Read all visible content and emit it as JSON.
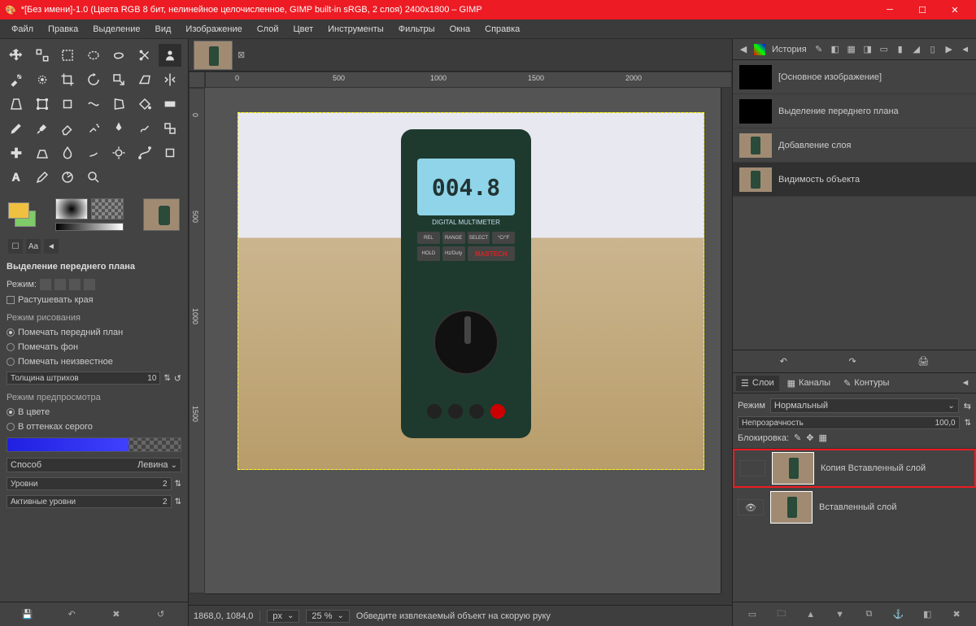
{
  "titlebar": {
    "text": "*[Без имени]-1.0 (Цвета RGB 8 бит, нелинейное целочисленное, GIMP built-in sRGB, 2 слоя) 2400x1800 – GIMP"
  },
  "menu": {
    "file": "Файл",
    "edit": "Правка",
    "select": "Выделение",
    "view": "Вид",
    "image": "Изображение",
    "layer": "Слой",
    "color": "Цвет",
    "tools": "Инструменты",
    "filters": "Фильтры",
    "windows": "Окна",
    "help": "Справка"
  },
  "colors": {
    "fg": "#f0c040",
    "bg": "#7ecb68"
  },
  "tool_options": {
    "title": "Выделение переднего плана",
    "mode_label": "Режим:",
    "feather": "Растушевать края",
    "draw_mode": "Режим рисования",
    "mark_fg": "Помечать передний план",
    "mark_bg": "Помечать фон",
    "mark_unknown": "Помечать неизвестное",
    "stroke_label": "Толщина штрихов",
    "stroke_value": "10",
    "preview_mode": "Режим предпросмотра",
    "in_color": "В цвете",
    "in_gray": "В оттенках серого",
    "method_label": "Способ",
    "method_value": "Левина",
    "levels_label": "Уровни",
    "levels_value": "2",
    "active_levels_label": "Активные уровни",
    "active_levels_value": "2"
  },
  "ruler_h": [
    "0",
    "500",
    "1000",
    "1500",
    "2000"
  ],
  "ruler_v": [
    "0",
    "500",
    "1000",
    "1500"
  ],
  "multimeter": {
    "reading": "004.8",
    "label": "DIGITAL MULTIMETER",
    "brand": "MASTECH"
  },
  "status": {
    "coords": "1868,0, 1084,0",
    "unit": "px",
    "zoom": "25 %",
    "hint": "Обведите извлекаемый объект на скорую руку"
  },
  "history_tab": "История",
  "history": [
    {
      "label": "[Основное изображение]",
      "img": false
    },
    {
      "label": "Выделение переднего плана",
      "img": false
    },
    {
      "label": "Добавление слоя",
      "img": true
    },
    {
      "label": "Видимость объекта",
      "img": true
    }
  ],
  "layers_panel": {
    "tab_layers": "Слои",
    "tab_channels": "Каналы",
    "tab_paths": "Контуры",
    "mode_label": "Режим",
    "mode_value": "Нормальный",
    "opacity_label": "Непрозрачность",
    "opacity_value": "100,0",
    "lock_label": "Блокировка:"
  },
  "layers": [
    {
      "name": "Копия Вставленный слой",
      "selected": true,
      "visible": false
    },
    {
      "name": "Вставленный слой",
      "selected": false,
      "visible": true
    }
  ]
}
